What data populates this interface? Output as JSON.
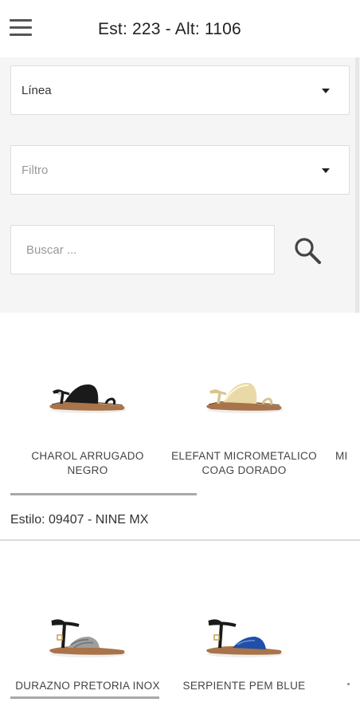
{
  "header": {
    "title": "Est: 223 - Alt: 1106"
  },
  "filters": {
    "linea_label": "Línea",
    "filtro_placeholder": "Filtro",
    "search_placeholder": "Buscar ..."
  },
  "sections": [
    {
      "products": [
        {
          "name": "CHAROL ARRUGADO NEGRO",
          "strap_color": "#1a1a1a",
          "sole_color": "#a9744a"
        },
        {
          "name": "ELEFANT MICROMETALICO COAG DORADO",
          "strap_color": "#e9d9a6",
          "sole_color": "#a9744a"
        },
        {
          "name": "MI",
          "strap_color": "",
          "sole_color": ""
        }
      ],
      "style_label": "Estilo: 09407 - NINE MX"
    },
    {
      "products": [
        {
          "name": "DURAZNO PRETORIA INOX",
          "strap_color": "#9e9e9e",
          "sole_color": "#a9744a"
        },
        {
          "name": "SERPIENTE PEM BLUE",
          "strap_color": "#1f4fa8",
          "sole_color": "#a9744a"
        }
      ]
    }
  ],
  "icons": {
    "menu": "hamburger-menu-icon",
    "dropdown": "caret-down-icon",
    "search": "magnifier-icon"
  }
}
